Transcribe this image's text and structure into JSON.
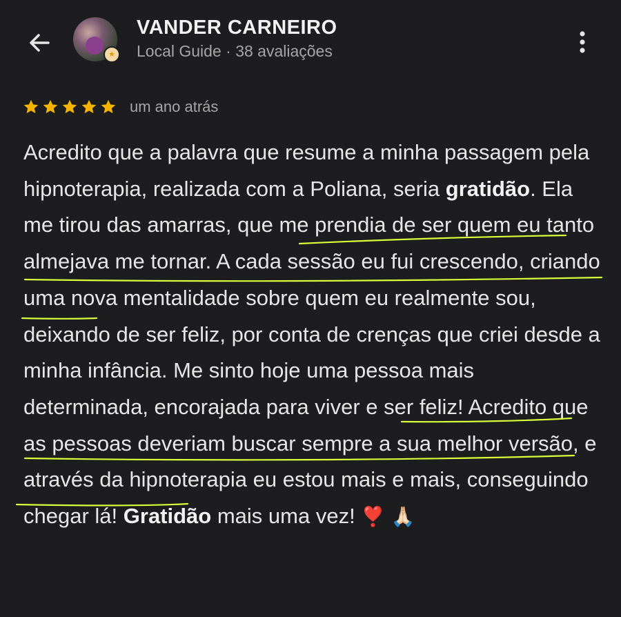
{
  "header": {
    "back_icon": "arrow-left-icon",
    "reviewer_name": "VANDER CARNEIRO",
    "reviewer_meta": "Local Guide · 38 avaliações",
    "badge_icon": "local-guide-star-icon",
    "more_icon": "more-vertical-icon"
  },
  "review": {
    "rating": 5,
    "rating_max": 5,
    "star_color": "#f4b400",
    "time": "um ano atrás",
    "text_parts": [
      "Acredito que a palavra que resume a minha passagem pela hipnoterapia, realizada com a Poliana, seria ",
      "gratidão",
      ". Ela me tirou das amarras, que me prendia de ser quem eu tanto almejava me tornar. A cada sessão eu fui crescendo, criando uma nova mentalidade sobre quem eu realmente sou, deixando de ser feliz, por conta de crenças que criei desde a minha infância. Me sinto hoje uma pessoa mais determinada, encorajada para viver e ser feliz! Acredito que as pessoas deveriam buscar sempre a sua melhor versão, e através da hipnoterapia eu estou mais e mais, conseguindo chegar lá! ",
      "Gratidão",
      " mais uma vez! ",
      "❣️",
      "🙏🏻"
    ]
  },
  "colors": {
    "background": "#1d1d1f",
    "text": "#e6e6e6",
    "secondary_text": "#a6a6a6",
    "highlight_underline": "#d9ff3a"
  }
}
